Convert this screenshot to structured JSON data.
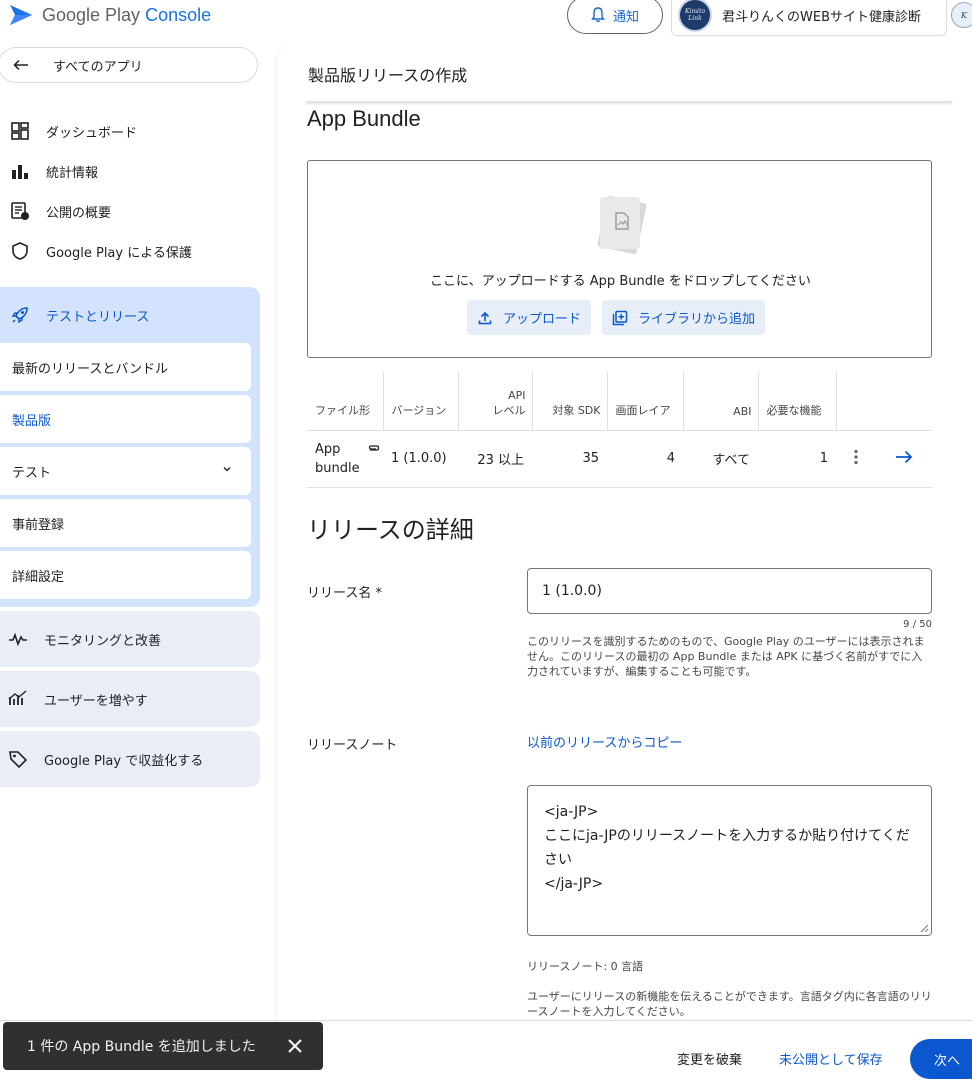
{
  "header": {
    "logo_prefix": "Google Play",
    "logo_suffix": "Console",
    "notify_label": "通知",
    "account_name": "君斗りんくのWEBサイト健康診断",
    "avatar_text": "Kimito Link"
  },
  "sidebar": {
    "all_apps": "すべてのアプリ",
    "nav": [
      {
        "label": "ダッシュボード",
        "icon": "dashboard-icon"
      },
      {
        "label": "統計情報",
        "icon": "bar-chart-icon"
      },
      {
        "label": "公開の概要",
        "icon": "publishing-overview-icon"
      },
      {
        "label": "Google Play による保護",
        "icon": "shield-icon"
      }
    ],
    "test_release": {
      "label": "テストとリリース",
      "icon": "rocket-icon",
      "items": [
        "最新のリリースとバンドル",
        "製品版",
        "テスト",
        "事前登録",
        "詳細設定"
      ],
      "active_item": "製品版"
    },
    "sections": [
      {
        "label": "モニタリングと改善",
        "icon": "pulse-icon"
      },
      {
        "label": "ユーザーを増やす",
        "icon": "grow-users-icon"
      },
      {
        "label": "Google Play で収益化する",
        "icon": "tag-icon"
      }
    ]
  },
  "main": {
    "page_title": "製品版リリースの作成",
    "app_bundle_heading": "App Bundle",
    "drop_text": "ここに、アップロードする App Bundle をドロップしてください",
    "upload_label": "アップロード",
    "library_label": "ライブラリから追加",
    "table": {
      "headers": [
        "ファイル形",
        "バージョン",
        "API レベル",
        "対象 SDK",
        "画面レイア",
        "ABI",
        "必要な機能"
      ],
      "api_header_line1": "API",
      "api_header_line2": "レベル",
      "row": {
        "type_line1": "App",
        "type_line2": "bundle",
        "version": "1 (1.0.0)",
        "api": "23 以上",
        "target_sdk": "35",
        "screen": "4",
        "abi": "すべて",
        "features": "1"
      }
    },
    "details_heading": "リリースの詳細",
    "release_name_label": "リリース名 *",
    "release_name_value": "1 (1.0.0)",
    "release_name_counter": "9 / 50",
    "release_name_help": "このリリースを識別するためのもので、Google Play のユーザーには表示されません。このリリースの最初の App Bundle または APK に基づく名前がすでに入力されていますが、編集することも可能です。",
    "release_notes_label": "リリースノート",
    "copy_link": "以前のリリースからコピー",
    "notes_line1": "<ja-JP>",
    "notes_line2": "ここにja-JPのリリースノートを入力するか貼り付けてください",
    "notes_line3": "</ja-JP>",
    "notes_count": "リリースノート: 0 言語",
    "notes_help": "ユーザーにリリースの新機能を伝えることができます。言語タグ内に各言語のリリースノートを入力してください。"
  },
  "footer": {
    "discard": "変更を破棄",
    "save_draft": "未公開として保存",
    "next": "次へ"
  },
  "snackbar": {
    "message": "1 件の App Bundle を追加しました"
  },
  "colors": {
    "accent": "#0b57d0",
    "nav_active_bg": "#d3e3fd",
    "section_bg": "#e9edf6",
    "snackbar_bg": "#303030"
  }
}
